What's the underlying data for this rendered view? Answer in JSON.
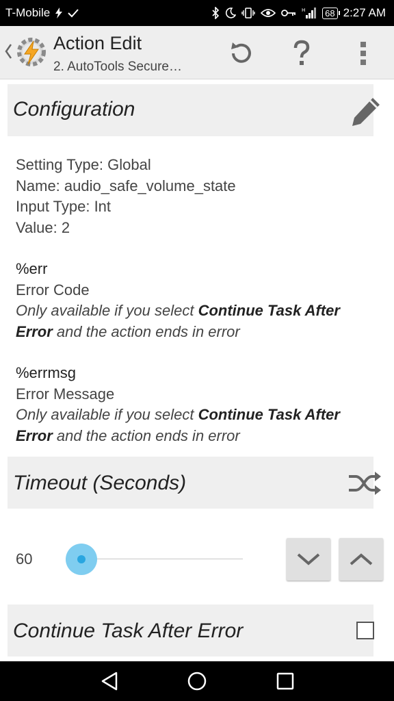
{
  "status_bar": {
    "carrier": "T-Mobile",
    "battery": "68",
    "time": "2:27 AM"
  },
  "action_bar": {
    "title": "Action Edit",
    "subtitle": "2. AutoTools Secure…",
    "icons": [
      "back-chevron-icon",
      "tasker-app-icon",
      "undo-icon",
      "help-icon",
      "overflow-menu-icon"
    ]
  },
  "configuration": {
    "header": "Configuration",
    "edit_icon": "pencil-icon",
    "lines": [
      "Setting Type: Global",
      "Name: audio_safe_volume_state",
      "Input Type: Int",
      "Value: 2"
    ]
  },
  "variables": [
    {
      "name": "%err",
      "desc": "Error Code",
      "note_before": "Only available if you select ",
      "note_bold1": "Continue Task After",
      "note_bold2": "Error",
      "note_after": " and the action ends in error"
    },
    {
      "name": "%errmsg",
      "desc": "Error Message",
      "note_before": "Only available if you select ",
      "note_bold1": "Continue Task After",
      "note_bold2": "Error",
      "note_after": " and the action ends in error"
    }
  ],
  "timeout": {
    "header": "Timeout (Seconds)",
    "icon": "shuffle-icon",
    "value": "60",
    "slider_fraction": 0.0
  },
  "continue_task": {
    "label": "Continue Task After Error",
    "checked": false
  },
  "colors": {
    "accent": "#29a6e0",
    "thumb": "#7fcdf0",
    "header_bg": "#efefef",
    "action_bar_bg": "#eeeeee"
  }
}
